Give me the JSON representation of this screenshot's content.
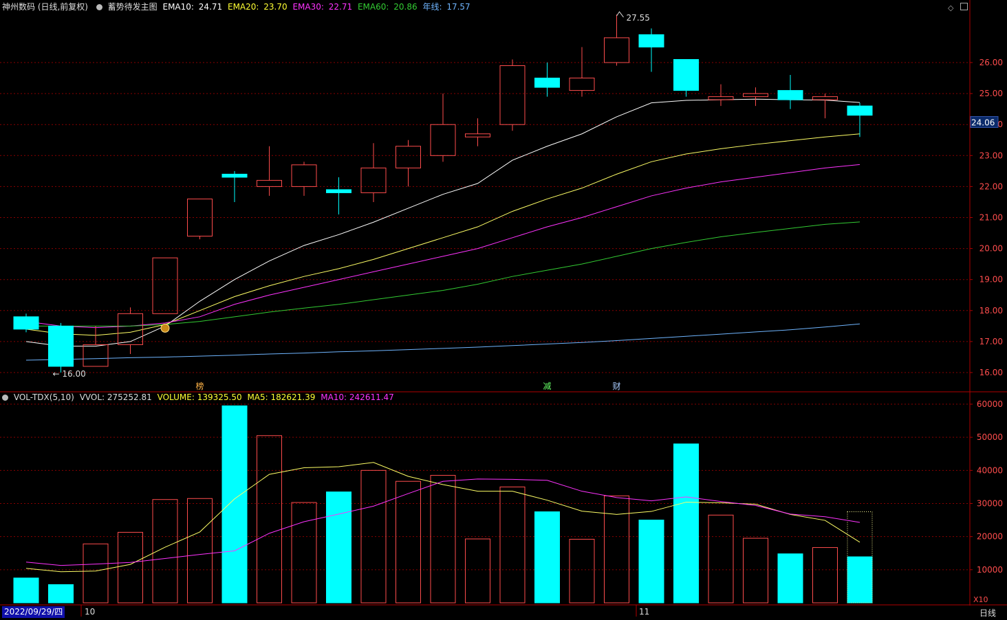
{
  "header": {
    "stock": "神州数码 (日线,前复权)",
    "indicator_name": "蓄势待发主图",
    "ema10_label": "EMA10:",
    "ema10_value": "24.71",
    "ema20_label": "EMA20:",
    "ema20_value": "23.70",
    "ema30_label": "EMA30:",
    "ema30_value": "22.71",
    "ema60_label": "EMA60:",
    "ema60_value": "20.86",
    "year_label": "年线:",
    "year_value": "17.57"
  },
  "vol_header": {
    "name": "VOL-TDX(5,10)",
    "vvol": "VVOL: 275252.81",
    "volume": "VOLUME: 139325.50",
    "ma5": "MA5: 182621.39",
    "ma10": "MA10: 242611.47"
  },
  "colors": {
    "up": "#ff4d4d",
    "down": "#00ffff",
    "ema10": "#ffffff",
    "ema20": "#ffff66",
    "ema30": "#ff33ff",
    "ema60": "#33cc33",
    "year": "#6fb5ff",
    "grid": "#8b0000",
    "frame": "#b00000",
    "ma5": "#ffff66",
    "ma10": "#ff33ff"
  },
  "chart_data": [
    {
      "type": "candlestick",
      "ylim": [
        15.7,
        27.8
      ],
      "yticks": [
        16.0,
        17.0,
        18.0,
        19.0,
        20.0,
        21.0,
        22.0,
        23.0,
        24.0,
        25.0,
        26.0
      ],
      "last_price_tag": "24.06",
      "high_annotation": {
        "index": 17,
        "value": 27.55,
        "label": "27.55"
      },
      "low_annotation": {
        "index": 1,
        "value": 16.0,
        "label": "16.00"
      },
      "candles": [
        {
          "o": 17.8,
          "h": 17.9,
          "l": 17.3,
          "c": 17.4
        },
        {
          "o": 17.5,
          "h": 17.6,
          "l": 16.0,
          "c": 16.2
        },
        {
          "o": 16.2,
          "h": 17.5,
          "l": 16.2,
          "c": 16.9
        },
        {
          "o": 16.9,
          "h": 18.1,
          "l": 16.6,
          "c": 17.9
        },
        {
          "o": 17.9,
          "h": 19.7,
          "l": 17.9,
          "c": 19.7
        },
        {
          "o": 20.4,
          "h": 21.6,
          "l": 20.3,
          "c": 21.6
        },
        {
          "o": 22.4,
          "h": 22.5,
          "l": 21.5,
          "c": 22.3
        },
        {
          "o": 22.0,
          "h": 23.3,
          "l": 21.7,
          "c": 22.2
        },
        {
          "o": 22.0,
          "h": 22.8,
          "l": 21.7,
          "c": 22.7
        },
        {
          "o": 21.9,
          "h": 22.3,
          "l": 21.1,
          "c": 21.8
        },
        {
          "o": 21.8,
          "h": 23.4,
          "l": 21.5,
          "c": 22.6
        },
        {
          "o": 22.6,
          "h": 23.5,
          "l": 22.0,
          "c": 23.3
        },
        {
          "o": 23.0,
          "h": 25.0,
          "l": 22.8,
          "c": 24.0
        },
        {
          "o": 23.6,
          "h": 24.2,
          "l": 23.3,
          "c": 23.7
        },
        {
          "o": 24.0,
          "h": 26.1,
          "l": 23.8,
          "c": 25.9
        },
        {
          "o": 25.5,
          "h": 26.0,
          "l": 24.9,
          "c": 25.2
        },
        {
          "o": 25.1,
          "h": 26.5,
          "l": 24.9,
          "c": 25.5
        },
        {
          "o": 26.0,
          "h": 27.55,
          "l": 25.9,
          "c": 26.8
        },
        {
          "o": 26.9,
          "h": 27.1,
          "l": 25.7,
          "c": 26.5
        },
        {
          "o": 26.1,
          "h": 26.1,
          "l": 24.9,
          "c": 25.1
        },
        {
          "o": 24.8,
          "h": 25.3,
          "l": 24.6,
          "c": 24.9
        },
        {
          "o": 24.9,
          "h": 25.2,
          "l": 24.6,
          "c": 25.0
        },
        {
          "o": 25.1,
          "h": 25.6,
          "l": 24.5,
          "c": 24.8
        },
        {
          "o": 24.8,
          "h": 25.0,
          "l": 24.2,
          "c": 24.9
        },
        {
          "o": 24.6,
          "h": 24.7,
          "l": 23.6,
          "c": 24.3
        }
      ],
      "series": [
        {
          "key": "ema10",
          "values": [
            17.0,
            16.85,
            16.85,
            17.0,
            17.5,
            18.3,
            19.0,
            19.6,
            20.1,
            20.45,
            20.85,
            21.3,
            21.75,
            22.1,
            22.85,
            23.3,
            23.7,
            24.25,
            24.7,
            24.78,
            24.8,
            24.82,
            24.8,
            24.79,
            24.71
          ]
        },
        {
          "key": "ema20",
          "values": [
            17.4,
            17.25,
            17.2,
            17.3,
            17.55,
            18.0,
            18.45,
            18.8,
            19.1,
            19.35,
            19.65,
            20.0,
            20.35,
            20.7,
            21.2,
            21.6,
            21.95,
            22.4,
            22.8,
            23.05,
            23.22,
            23.36,
            23.48,
            23.6,
            23.7
          ]
        },
        {
          "key": "ema30",
          "values": [
            17.65,
            17.5,
            17.45,
            17.5,
            17.6,
            17.8,
            18.2,
            18.5,
            18.75,
            19.0,
            19.25,
            19.5,
            19.75,
            20.0,
            20.35,
            20.7,
            21.0,
            21.35,
            21.7,
            21.95,
            22.15,
            22.3,
            22.45,
            22.6,
            22.71
          ]
        },
        {
          "key": "ema60",
          "values": [
            17.5,
            17.5,
            17.5,
            17.5,
            17.55,
            17.65,
            17.8,
            17.95,
            18.08,
            18.2,
            18.35,
            18.5,
            18.65,
            18.85,
            19.1,
            19.3,
            19.5,
            19.75,
            20.0,
            20.2,
            20.38,
            20.52,
            20.65,
            20.78,
            20.86
          ]
        },
        {
          "key": "year",
          "values": [
            16.4,
            16.42,
            16.45,
            16.48,
            16.5,
            16.53,
            16.56,
            16.6,
            16.63,
            16.67,
            16.7,
            16.74,
            16.78,
            16.82,
            16.87,
            16.92,
            16.97,
            17.03,
            17.1,
            17.17,
            17.24,
            17.31,
            17.38,
            17.47,
            17.57
          ]
        }
      ],
      "signals": [
        {
          "index": 4,
          "value": 17.5,
          "label": "💰"
        }
      ],
      "events": [
        {
          "index": 5,
          "label": "榜",
          "color": "#ffb347"
        },
        {
          "index": 15,
          "label": "减",
          "color": "#66ff66"
        },
        {
          "index": 17,
          "label": "财",
          "color": "#aaccff"
        }
      ]
    },
    {
      "type": "bar",
      "ylim": [
        0,
        60000
      ],
      "yticks": [
        10000,
        20000,
        30000,
        40000,
        50000,
        60000
      ],
      "unit_label": "X10",
      "volumes": [
        7500,
        5500,
        17800,
        21300,
        31200,
        31500,
        59500,
        50500,
        30300,
        33500,
        40000,
        36700,
        38500,
        19300,
        35000,
        27500,
        19200,
        32300,
        25000,
        48000,
        26500,
        19500,
        14800,
        16700,
        13900
      ],
      "ma5": [
        10400,
        9400,
        9600,
        11600,
        16800,
        21400,
        31400,
        38800,
        40800,
        41100,
        42400,
        38200,
        35700,
        33700,
        33700,
        31000,
        27700,
        26700,
        27600,
        30400,
        30200,
        29800,
        26700,
        24900,
        18300
      ],
      "ma10": [
        12300,
        11300,
        11700,
        12200,
        13400,
        14600,
        15700,
        21000,
        24500,
        26800,
        29200,
        33000,
        36700,
        37400,
        37300,
        37000,
        33700,
        31800,
        30800,
        32000,
        30600,
        29400,
        26800,
        26000,
        24300
      ]
    }
  ],
  "x_axis": {
    "date_label": "2022/09/29/四",
    "month_10": "10",
    "month_11": "11",
    "period_label": "日线"
  }
}
